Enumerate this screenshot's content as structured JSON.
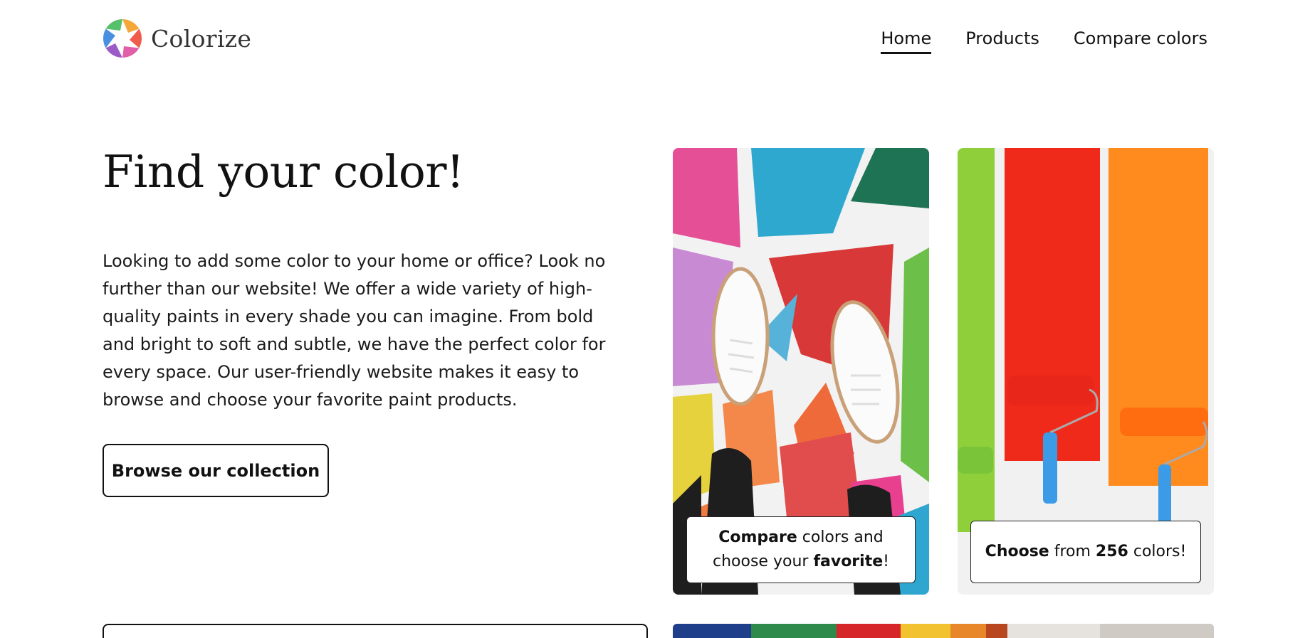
{
  "brand": {
    "name": "Colorize",
    "logo_icon": "aperture-logo-icon"
  },
  "nav": {
    "items": [
      {
        "label": "Home",
        "active": true
      },
      {
        "label": "Products",
        "active": false
      },
      {
        "label": "Compare colors",
        "active": false
      }
    ]
  },
  "hero": {
    "title": "Find your color!",
    "text": "Looking to add some color to your home or office? Look no further than our website! We offer a wide variety of high-quality paints in every shade you can imagine. From bold and bright to soft and subtle, we have the perfect color for every space. Our user-friendly website makes it easy to browse and choose your favorite paint products.",
    "button_label": "Browse our collection"
  },
  "cards": [
    {
      "image": "sneakers-on-colorful-floor-image",
      "caption": {
        "part1_bold": "Compare",
        "part2": " colors and choose your ",
        "part3_bold": "favorite",
        "part4": "!"
      }
    },
    {
      "image": "paint-rollers-stripes-image",
      "caption": {
        "part1_bold": "Choose",
        "part2": " from ",
        "part3_bold": "256",
        "part4": " colors!"
      }
    }
  ],
  "colors": {
    "text": "#111111",
    "background": "#ffffff"
  }
}
